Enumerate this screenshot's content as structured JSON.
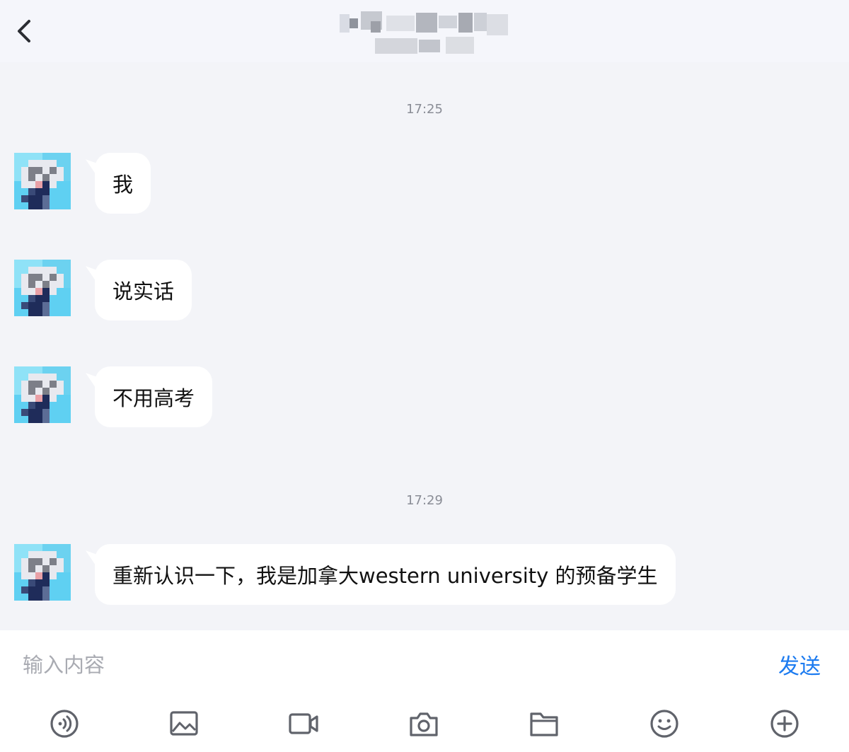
{
  "header": {
    "back_icon": "chevron-left-icon",
    "title_blurred": true
  },
  "messages": [
    {
      "time": "17:25"
    },
    {
      "text": "我"
    },
    {
      "text": "说实话"
    },
    {
      "text": "不用高考"
    },
    {
      "time": "17:29"
    },
    {
      "text": "重新认识一下，我是加拿大western university 的预备学生"
    }
  ],
  "composer": {
    "placeholder": "输入内容",
    "send_label": "发送",
    "accent_color": "#1c7bf0"
  },
  "toolbar": {
    "icons": [
      "voice-icon",
      "image-icon",
      "video-icon",
      "camera-icon",
      "folder-icon",
      "emoji-icon",
      "plus-circle-icon"
    ]
  }
}
